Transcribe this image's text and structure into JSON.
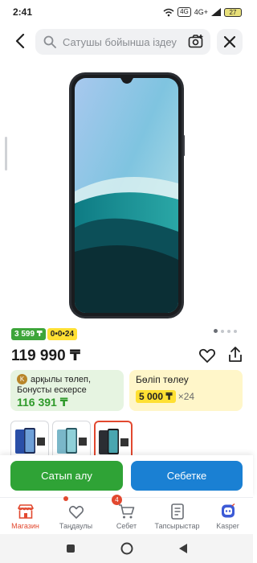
{
  "status_bar": {
    "time": "2:41",
    "network": "4G+",
    "battery": "27"
  },
  "search": {
    "placeholder": "Сатушы бойынша іздеу"
  },
  "badges": {
    "credit": "3 599 ₸",
    "installment": "0•0•24"
  },
  "product": {
    "price": "119 990 ₸"
  },
  "bonus_card": {
    "line1": "арқылы төлеп,",
    "line2": "Бонусты ескерсе",
    "value": "116 391 ₸"
  },
  "installment_card": {
    "title": "Бөліп төлеу",
    "amount": "5 000 ₸",
    "multiplier": "×24"
  },
  "actions": {
    "buy_label": "Сатып алу",
    "cart_label": "Себетке"
  },
  "bottom_nav": [
    {
      "label": "Магазин",
      "icon": "store-icon",
      "active": true
    },
    {
      "label": "Таңдаулы",
      "icon": "heart-icon"
    },
    {
      "label": "Себет",
      "icon": "cart-icon",
      "badge": "4"
    },
    {
      "label": "Тапсырыстар",
      "icon": "orders-icon"
    },
    {
      "label": "Kasper",
      "icon": "kasper-icon"
    }
  ],
  "colors": {
    "accent_red": "#e2482f",
    "buy_green": "#2fa336",
    "cart_blue": "#1a80d3"
  }
}
